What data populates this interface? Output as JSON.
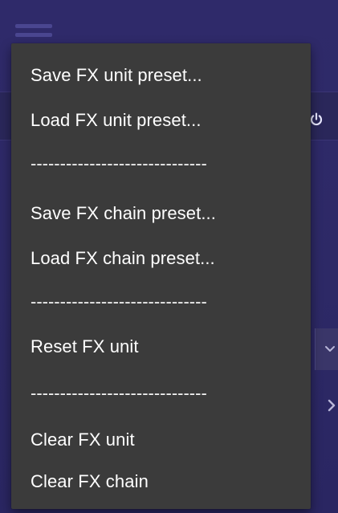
{
  "menu": {
    "items": [
      "Save FX unit preset...",
      "Load FX unit preset...",
      "------------------------------",
      "Save FX chain preset...",
      "Load FX chain preset...",
      "------------------------------",
      "Reset FX unit",
      "------------------------------",
      "Clear FX unit",
      "Clear FX chain"
    ]
  },
  "icons": {
    "hamburger": "menu-icon",
    "power": "power-icon",
    "dropdown": "chevron-down-icon",
    "side_arrow": "chevron-right-icon"
  },
  "colors": {
    "app_background": "#2f2a6a",
    "menu_background": "#3b3b3b",
    "menu_text": "#ffffff"
  }
}
